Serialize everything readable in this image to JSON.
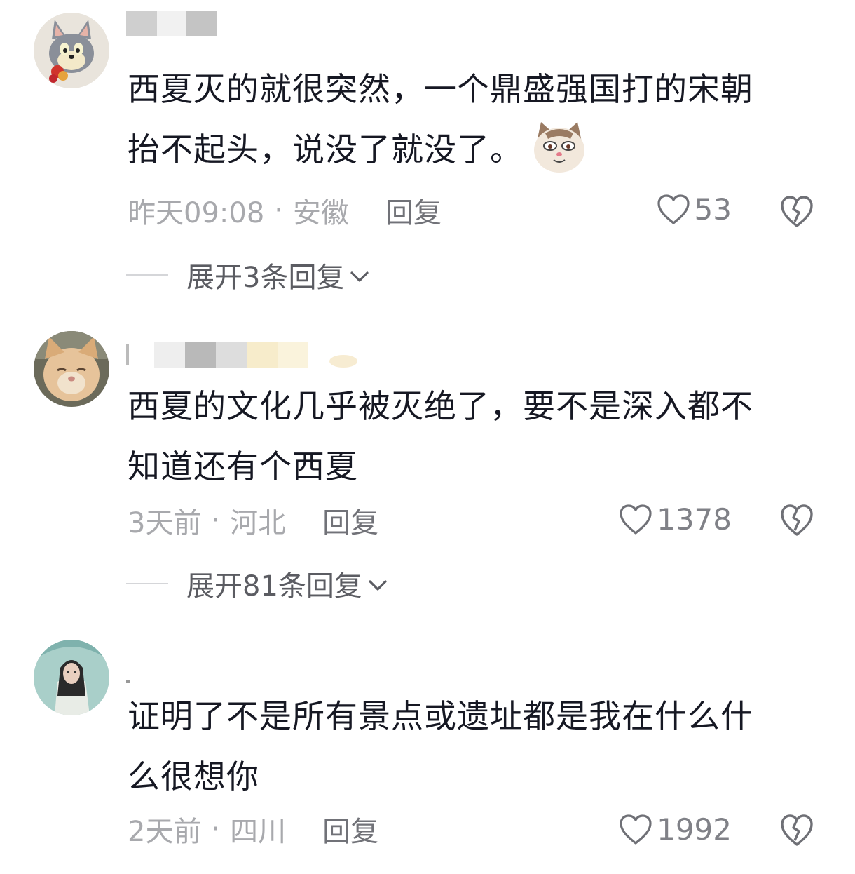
{
  "comments": [
    {
      "text_line1": "西夏灭的就很突然，一个鼎盛强国打的宋朝",
      "text_line2": "抬不起头，说没了就没了。",
      "time": "昨天09:08",
      "location": "安徽",
      "reply_label": "回复",
      "likes": "53",
      "expand_label": "展开3条回复",
      "emoji_icon": "cat-face-emoji",
      "avatar_icon": "cartoon-cat-avatar"
    },
    {
      "text_line1": "西夏的文化几乎被灭绝了，要不是深入都不",
      "text_line2": "知道还有个西夏",
      "time": "3天前",
      "location": "河北",
      "reply_label": "回复",
      "likes": "1378",
      "expand_label": "展开81条回复",
      "avatar_icon": "cat-photo-avatar"
    },
    {
      "text_line1": "证明了不是所有景点或遗址都是我在什么什",
      "text_line2": "么很想你",
      "time": "2天前",
      "location": "四川",
      "reply_label": "回复",
      "likes": "1992",
      "avatar_icon": "girl-portrait-avatar"
    }
  ],
  "separator": "·",
  "colors": {
    "text": "#161823",
    "meta": "#a8a9ad",
    "reply": "#717278"
  }
}
